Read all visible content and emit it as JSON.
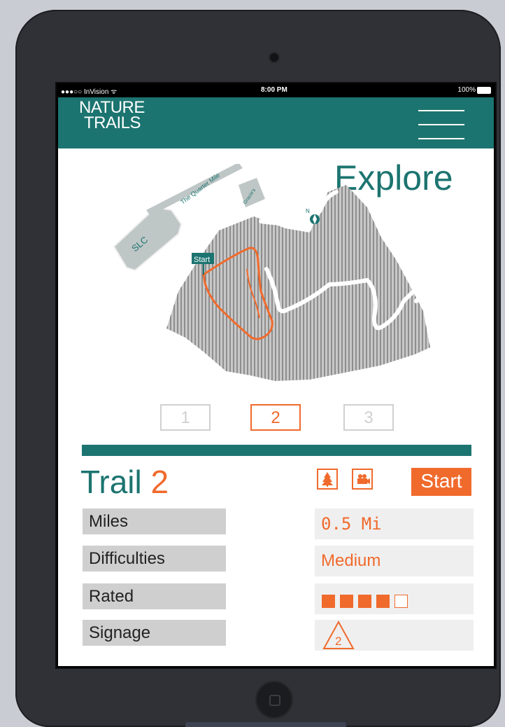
{
  "status": {
    "carrier": "●●●○○ InVision ᯤ",
    "time": "8:00 PM",
    "battery": "100%"
  },
  "header": {
    "brand_line1": "NATURE",
    "brand_line2": "TRAILS"
  },
  "page_title": "Explore",
  "map": {
    "label_slc": "SLC",
    "label_quarter_mile": "The Quarter Mile",
    "label_gracies": "Gracie's",
    "label_north": "N",
    "label_start": "Start"
  },
  "pager": [
    "1",
    "2",
    "3"
  ],
  "pager_selected": 2,
  "trail": {
    "title_word": "Trail",
    "number": "2",
    "start_label": "Start"
  },
  "details": {
    "miles_label": "Miles",
    "miles_value": "0.5 Mi",
    "difficulty_label": "Difficulties",
    "difficulty_value": "Medium",
    "rated_label": "Rated",
    "rating": 4,
    "rating_max": 5,
    "signage_label": "Signage",
    "signage_value": "2"
  },
  "colors": {
    "teal": "#1c7470",
    "orange": "#f06a2c"
  }
}
